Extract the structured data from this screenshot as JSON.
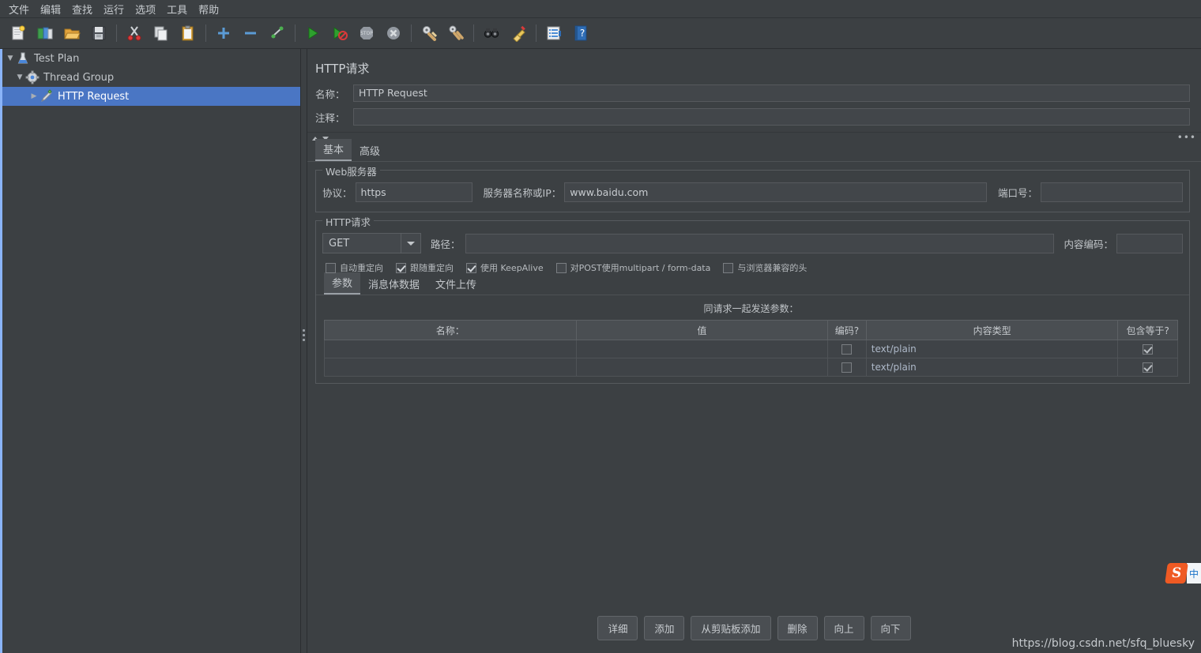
{
  "menubar": {
    "items": [
      {
        "label": "文件"
      },
      {
        "label": "编辑"
      },
      {
        "label": "查找"
      },
      {
        "label": "运行"
      },
      {
        "label": "选项"
      },
      {
        "label": "工具"
      },
      {
        "label": "帮助"
      }
    ]
  },
  "toolbar": {
    "icons": [
      {
        "name": "new-icon"
      },
      {
        "name": "templates-icon"
      },
      {
        "name": "open-icon"
      },
      {
        "name": "save-icon"
      },
      {
        "name": "cut-icon"
      },
      {
        "name": "copy-icon"
      },
      {
        "name": "paste-icon"
      },
      {
        "name": "expand-all-icon"
      },
      {
        "name": "collapse-all-icon"
      },
      {
        "name": "toggle-icon"
      },
      {
        "name": "start-icon"
      },
      {
        "name": "start-no-pauses-icon"
      },
      {
        "name": "stop-icon"
      },
      {
        "name": "shutdown-icon"
      },
      {
        "name": "clear-icon"
      },
      {
        "name": "clear-all-icon"
      },
      {
        "name": "search-icon"
      },
      {
        "name": "reset-search-icon"
      },
      {
        "name": "function-helper-icon"
      },
      {
        "name": "help-icon"
      }
    ]
  },
  "tree": {
    "nodes": [
      {
        "label": "Test Plan",
        "icon": "test-plan-icon",
        "expanded": true,
        "selected": false,
        "level": 0
      },
      {
        "label": "Thread Group",
        "icon": "thread-group-icon",
        "expanded": true,
        "selected": false,
        "level": 1
      },
      {
        "label": "HTTP Request",
        "icon": "http-request-icon",
        "expanded": false,
        "selected": true,
        "level": 2
      }
    ]
  },
  "panel": {
    "title": "HTTP请求",
    "name_label": "名称：",
    "name_value": "HTTP Request",
    "comment_label": "注释：",
    "comment_value": "",
    "tabs": [
      {
        "label": "基本",
        "active": true
      },
      {
        "label": "高级",
        "active": false
      }
    ],
    "web_server": {
      "title": "Web服务器",
      "protocol_label": "协议：",
      "protocol_value": "https",
      "server_label": "服务器名称或IP：",
      "server_value": "www.baidu.com",
      "port_label": "端口号：",
      "port_value": ""
    },
    "http_request": {
      "title": "HTTP请求",
      "method_value": "GET",
      "path_label": "路径：",
      "path_value": "",
      "content_encoding_label": "内容编码：",
      "content_encoding_value": "",
      "checkboxes": [
        {
          "label": "自动重定向",
          "checked": false
        },
        {
          "label": "跟随重定向",
          "checked": true
        },
        {
          "label": "使用 KeepAlive",
          "checked": true
        },
        {
          "label": "对POST使用multipart / form-data",
          "checked": false
        },
        {
          "label": "与浏览器兼容的头",
          "checked": false
        }
      ]
    },
    "param_tabs": [
      {
        "label": "参数",
        "active": true
      },
      {
        "label": "消息体数据",
        "active": false
      },
      {
        "label": "文件上传",
        "active": false
      }
    ],
    "table": {
      "caption": "同请求一起发送参数：",
      "headers": [
        "名称：",
        "值",
        "编码?",
        "内容类型",
        "包含等于?"
      ],
      "rows": [
        {
          "name": "",
          "value": "",
          "encode": false,
          "content_type": "text/plain",
          "include_equals": true
        },
        {
          "name": "",
          "value": "",
          "encode": false,
          "content_type": "text/plain",
          "include_equals": true
        }
      ]
    },
    "buttons": [
      {
        "label": "详细",
        "name": "detail-button"
      },
      {
        "label": "添加",
        "name": "add-button"
      },
      {
        "label": "从剪贴板添加",
        "name": "add-from-clipboard-button"
      },
      {
        "label": "删除",
        "name": "delete-button"
      },
      {
        "label": "向上",
        "name": "move-up-button"
      },
      {
        "label": "向下",
        "name": "move-down-button"
      }
    ]
  },
  "watermark": "https://blog.csdn.net/sfq_bluesky",
  "ime": {
    "logo": "S",
    "mode": "中"
  },
  "colors": {
    "accent": "#4a76c4",
    "background": "#3c4043",
    "text": "#bdc1c6"
  }
}
